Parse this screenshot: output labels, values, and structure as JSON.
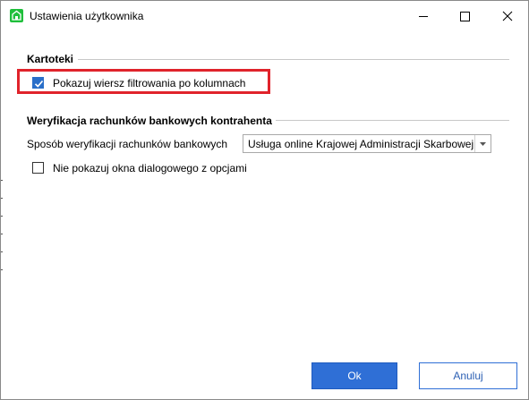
{
  "window": {
    "title": "Ustawienia użytkownika",
    "icon": "app-icon",
    "controls": {
      "minimize": "minimize-icon",
      "maximize": "maximize-icon",
      "close": "close-icon"
    }
  },
  "sections": {
    "kartoteki": {
      "title": "Kartoteki",
      "filter_row_label": "Pokazuj wiersz filtrowania po kolumnach",
      "filter_row_checked": true
    },
    "weryfikacja": {
      "title": "Weryfikacja rachunków bankowych kontrahenta",
      "method_label": "Sposób weryfikacji rachunków bankowych",
      "method_value": "Usługa online Krajowej Administracji Skarbowej",
      "no_dialog_label": "Nie pokazuj okna dialogowego z opcjami",
      "no_dialog_checked": false
    }
  },
  "buttons": {
    "ok": "Ok",
    "cancel": "Anuluj"
  },
  "colors": {
    "accent": "#2f6fd6",
    "highlight": "#e0232b",
    "app_icon": "#1fbf3b"
  }
}
